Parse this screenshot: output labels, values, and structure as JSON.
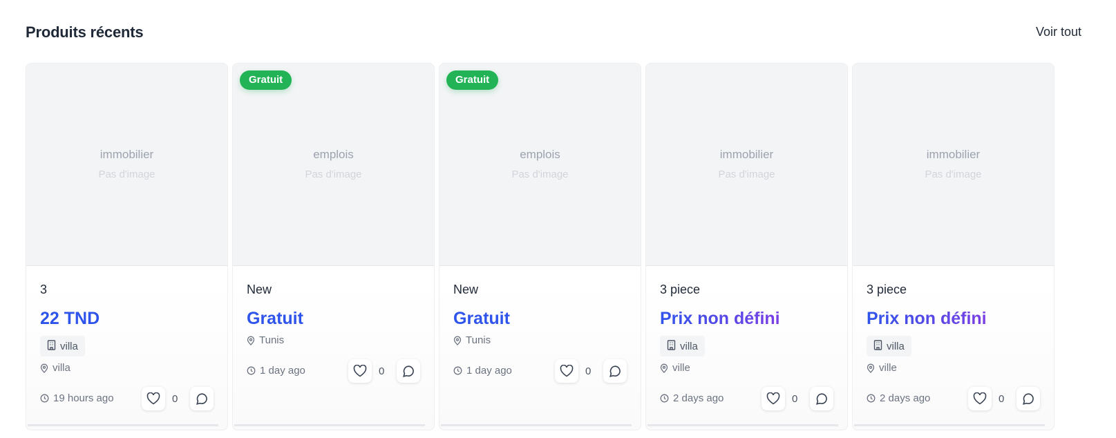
{
  "section": {
    "title": "Produits récents",
    "see_all_label": "Voir tout"
  },
  "cards": [
    {
      "category": "immobilier",
      "no_image_text": "Pas d'image",
      "badge": "",
      "subtitle": "3",
      "price": "22 TND",
      "price_style": "blue",
      "chip_label": "villa",
      "location": "villa",
      "time": "19 hours ago",
      "likes": "0"
    },
    {
      "category": "emplois",
      "no_image_text": "Pas d'image",
      "badge": "Gratuit",
      "subtitle": "New",
      "price": "Gratuit",
      "price_style": "blue",
      "chip_label": "",
      "location": "Tunis",
      "time": "1 day ago",
      "likes": "0"
    },
    {
      "category": "emplois",
      "no_image_text": "Pas d'image",
      "badge": "Gratuit",
      "subtitle": "New",
      "price": "Gratuit",
      "price_style": "blue",
      "chip_label": "",
      "location": "Tunis",
      "time": "1 day ago",
      "likes": "0"
    },
    {
      "category": "immobilier",
      "no_image_text": "Pas d'image",
      "badge": "",
      "subtitle": "3 piece",
      "price": "Prix non défini",
      "price_style": "gradient",
      "chip_label": "villa",
      "location": "ville",
      "time": "2 days ago",
      "likes": "0"
    },
    {
      "category": "immobilier",
      "no_image_text": "Pas d'image",
      "badge": "",
      "subtitle": "3 piece",
      "price": "Prix non défini",
      "price_style": "gradient",
      "chip_label": "villa",
      "location": "ville",
      "time": "2 days ago",
      "likes": "0"
    }
  ],
  "icons": {
    "building": "building-icon",
    "location": "map-pin-icon",
    "clock": "clock-icon",
    "heart": "heart-icon",
    "comment": "comment-icon"
  },
  "colors": {
    "price_blue": "#2f54eb",
    "price_gradient_end": "#7b3fe4",
    "badge_green": "#22b357"
  }
}
